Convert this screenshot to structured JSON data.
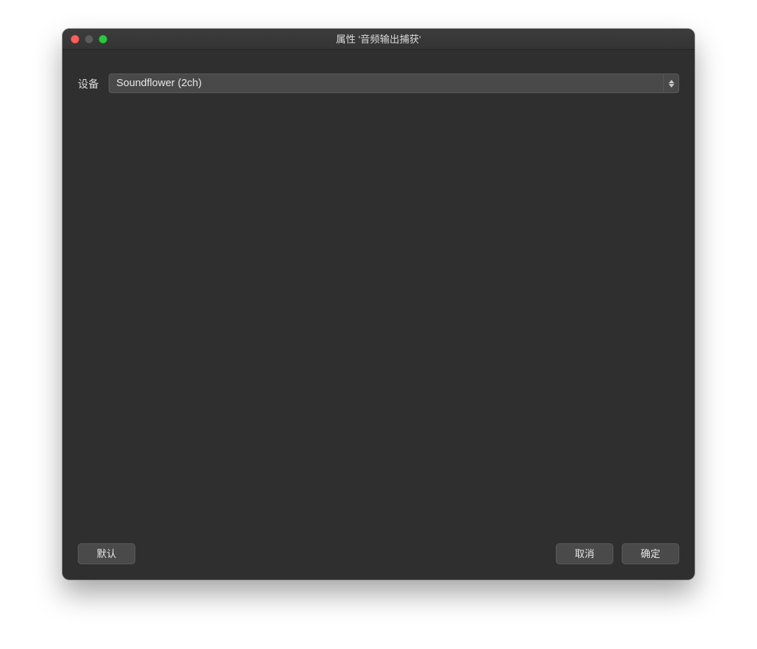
{
  "window": {
    "title": "属性 '音频输出捕获'"
  },
  "form": {
    "device_label": "设备",
    "device_value": "Soundflower (2ch)"
  },
  "buttons": {
    "default": "默认",
    "cancel": "取消",
    "ok": "确定"
  }
}
